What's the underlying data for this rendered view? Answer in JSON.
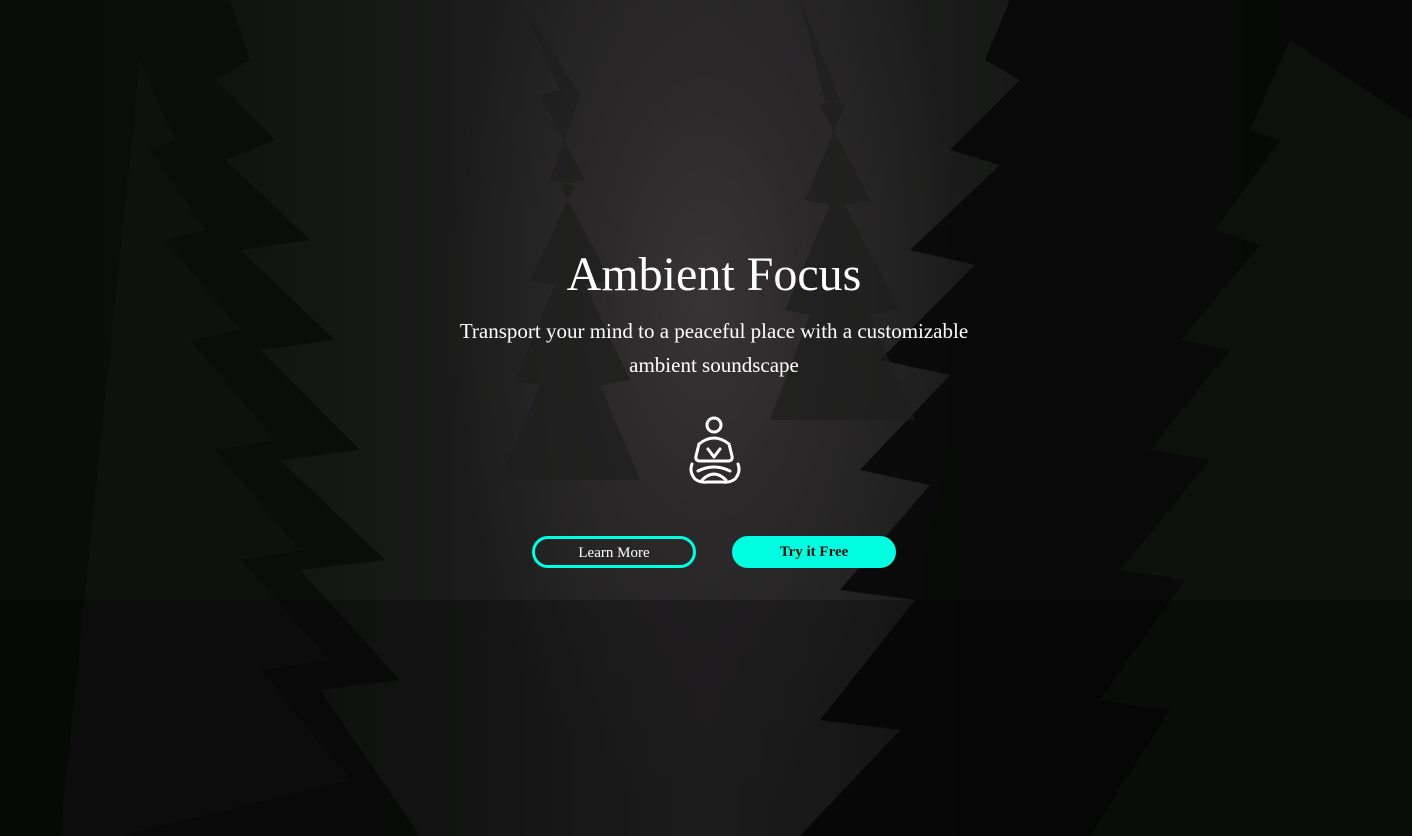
{
  "hero": {
    "title": "Ambient Focus",
    "subtitle": "Transport your mind to a peaceful place with a customizable ambient soundscape",
    "icon": "meditation-icon",
    "buttons": {
      "learn_more": "Learn More",
      "try_free": "Try it Free"
    }
  },
  "colors": {
    "accent": "#00ffe0",
    "background": "#1a1a1a",
    "text": "#ffffff"
  }
}
